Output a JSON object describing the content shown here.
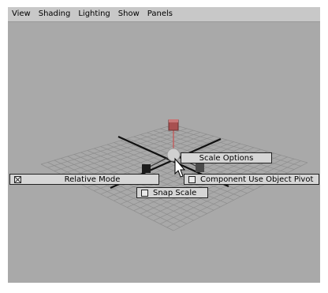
{
  "menubar": {
    "items": [
      "View",
      "Shading",
      "Lighting",
      "Show",
      "Panels"
    ]
  },
  "marking_menu": {
    "north": {
      "label": "Scale Options"
    },
    "west": {
      "label": "Relative Mode",
      "checked": true
    },
    "east": {
      "label": "Component Use Object Pivot",
      "checked": false
    },
    "south": {
      "label": "Snap Scale",
      "checked": false
    }
  },
  "colors": {
    "viewport_bg": "#a9a9a9",
    "menubar_bg": "#c8c8c8",
    "grid_line": "#8e8e8e",
    "axis_line": "#111111",
    "handle_red": "#a85050",
    "button_bg": "#d6d6d6"
  },
  "icons": {
    "cursor": "mouse-pointer-icon",
    "scale_handles": "scale-manipulator-icon"
  }
}
